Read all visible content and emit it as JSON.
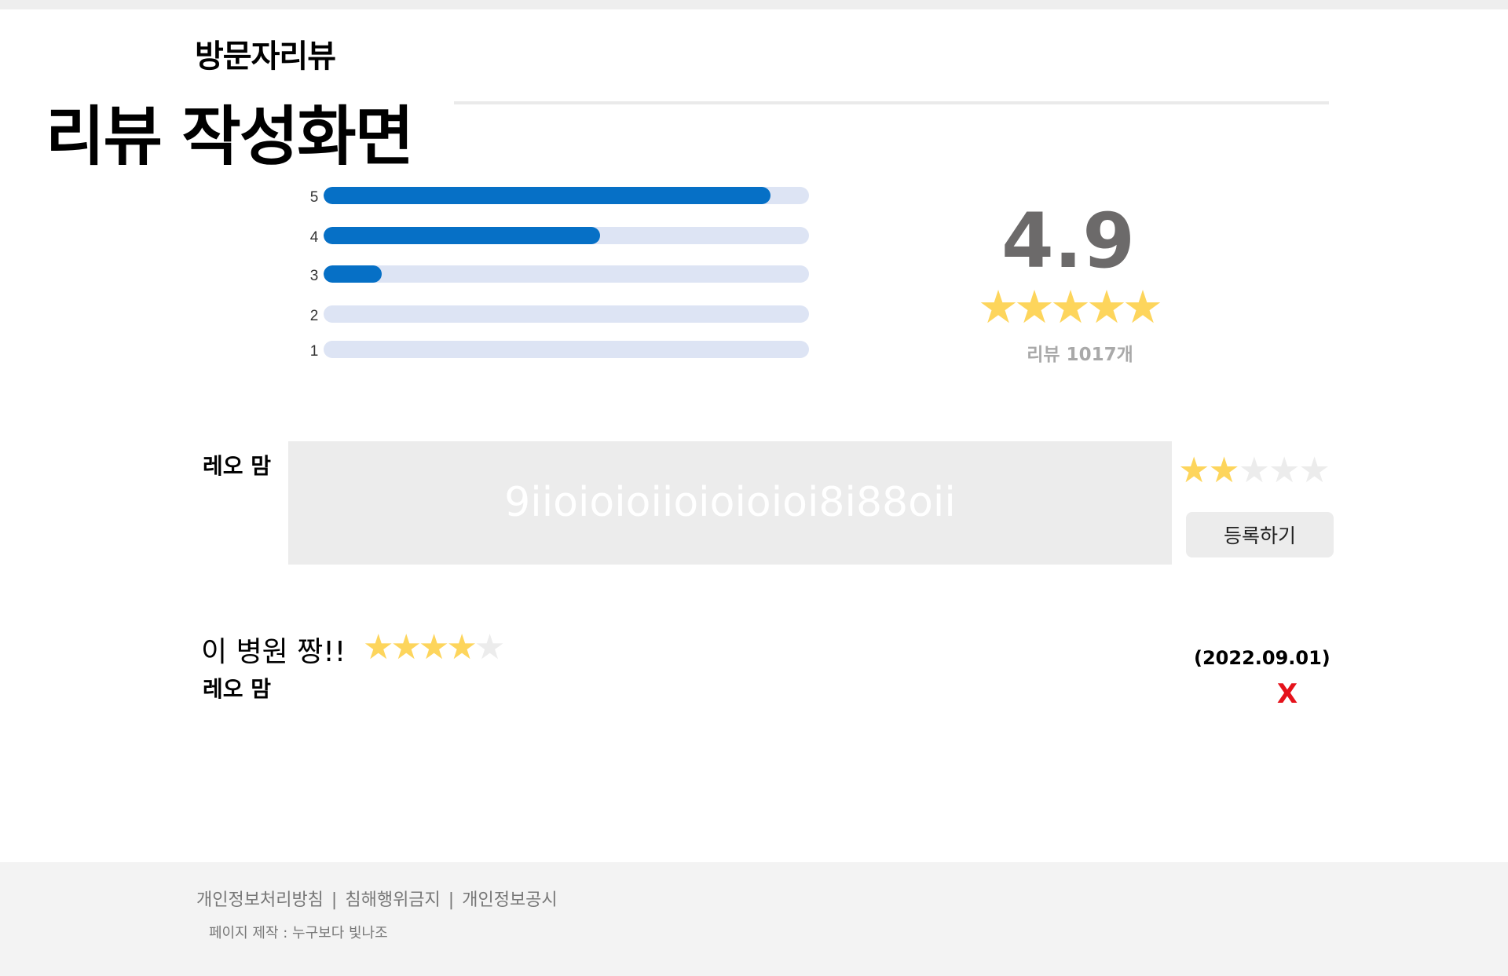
{
  "header": {
    "section_title": "방문자리뷰",
    "page_heading": "리뷰 작성화면"
  },
  "rating_summary": {
    "average": "4.9",
    "average_stars_filled": 5,
    "total_label": "리뷰 1017개",
    "histogram": [
      {
        "label": "5",
        "fill_fraction": 0.92
      },
      {
        "label": "4",
        "fill_fraction": 0.57
      },
      {
        "label": "3",
        "fill_fraction": 0.12
      },
      {
        "label": "2",
        "fill_fraction": 0
      },
      {
        "label": "1",
        "fill_fraction": 0
      }
    ]
  },
  "review_form": {
    "author": "레오 맘",
    "input_value": "9iioioioiioioioioi8i88oii",
    "rating": 2,
    "max_rating": 5,
    "submit_label": "등록하기"
  },
  "reviews": [
    {
      "title": "이 병원 짱!!",
      "rating": 4,
      "max_rating": 5,
      "author": "레오 맘",
      "date": "(2022.09.01)",
      "delete_label": "X"
    }
  ],
  "footer": {
    "links": [
      "개인정보처리방침",
      "침해행위금지",
      "개인정보공시"
    ],
    "separator": "|",
    "credit": "페이지 제작 : 누구보다 빛나조"
  },
  "colors": {
    "bar_fill": "#0670c6",
    "bar_track": "#dde4f4",
    "star_on": "#fdd55c",
    "star_off": "#ececec",
    "delete": "#e5121b"
  },
  "icons": {
    "star": "star-icon",
    "delete": "close-icon"
  }
}
